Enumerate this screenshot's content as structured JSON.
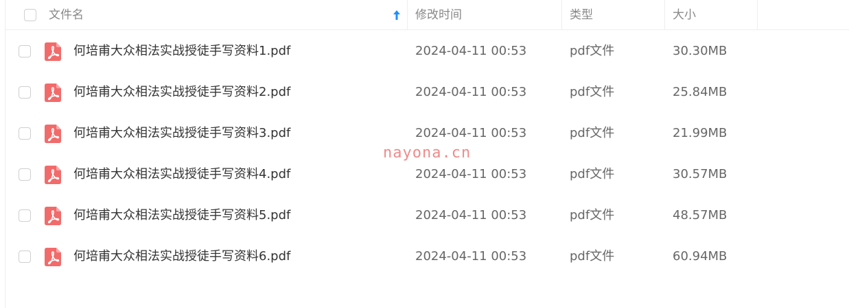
{
  "header": {
    "col_name": "文件名",
    "col_modified": "修改时间",
    "col_type": "类型",
    "col_size": "大小",
    "sort_icon": "sort-ascending-arrow-icon",
    "sort_color": "#1e90ff"
  },
  "files": [
    {
      "name": "何培甫大众相法实战授徒手写资料1.pdf",
      "modified": "2024-04-11 00:53",
      "type": "pdf文件",
      "size": "30.30MB"
    },
    {
      "name": "何培甫大众相法实战授徒手写资料2.pdf",
      "modified": "2024-04-11 00:53",
      "type": "pdf文件",
      "size": "25.84MB"
    },
    {
      "name": "何培甫大众相法实战授徒手写资料3.pdf",
      "modified": "2024-04-11 00:53",
      "type": "pdf文件",
      "size": "21.99MB"
    },
    {
      "name": "何培甫大众相法实战授徒手写资料4.pdf",
      "modified": "2024-04-11 00:53",
      "type": "pdf文件",
      "size": "30.57MB"
    },
    {
      "name": "何培甫大众相法实战授徒手写资料5.pdf",
      "modified": "2024-04-11 00:53",
      "type": "pdf文件",
      "size": "48.57MB"
    },
    {
      "name": "何培甫大众相法实战授徒手写资料6.pdf",
      "modified": "2024-04-11 00:53",
      "type": "pdf文件",
      "size": "60.94MB"
    }
  ],
  "file_icon": "pdf-file-icon",
  "file_icon_color": "#f26b6b",
  "watermark": "nayona.cn"
}
